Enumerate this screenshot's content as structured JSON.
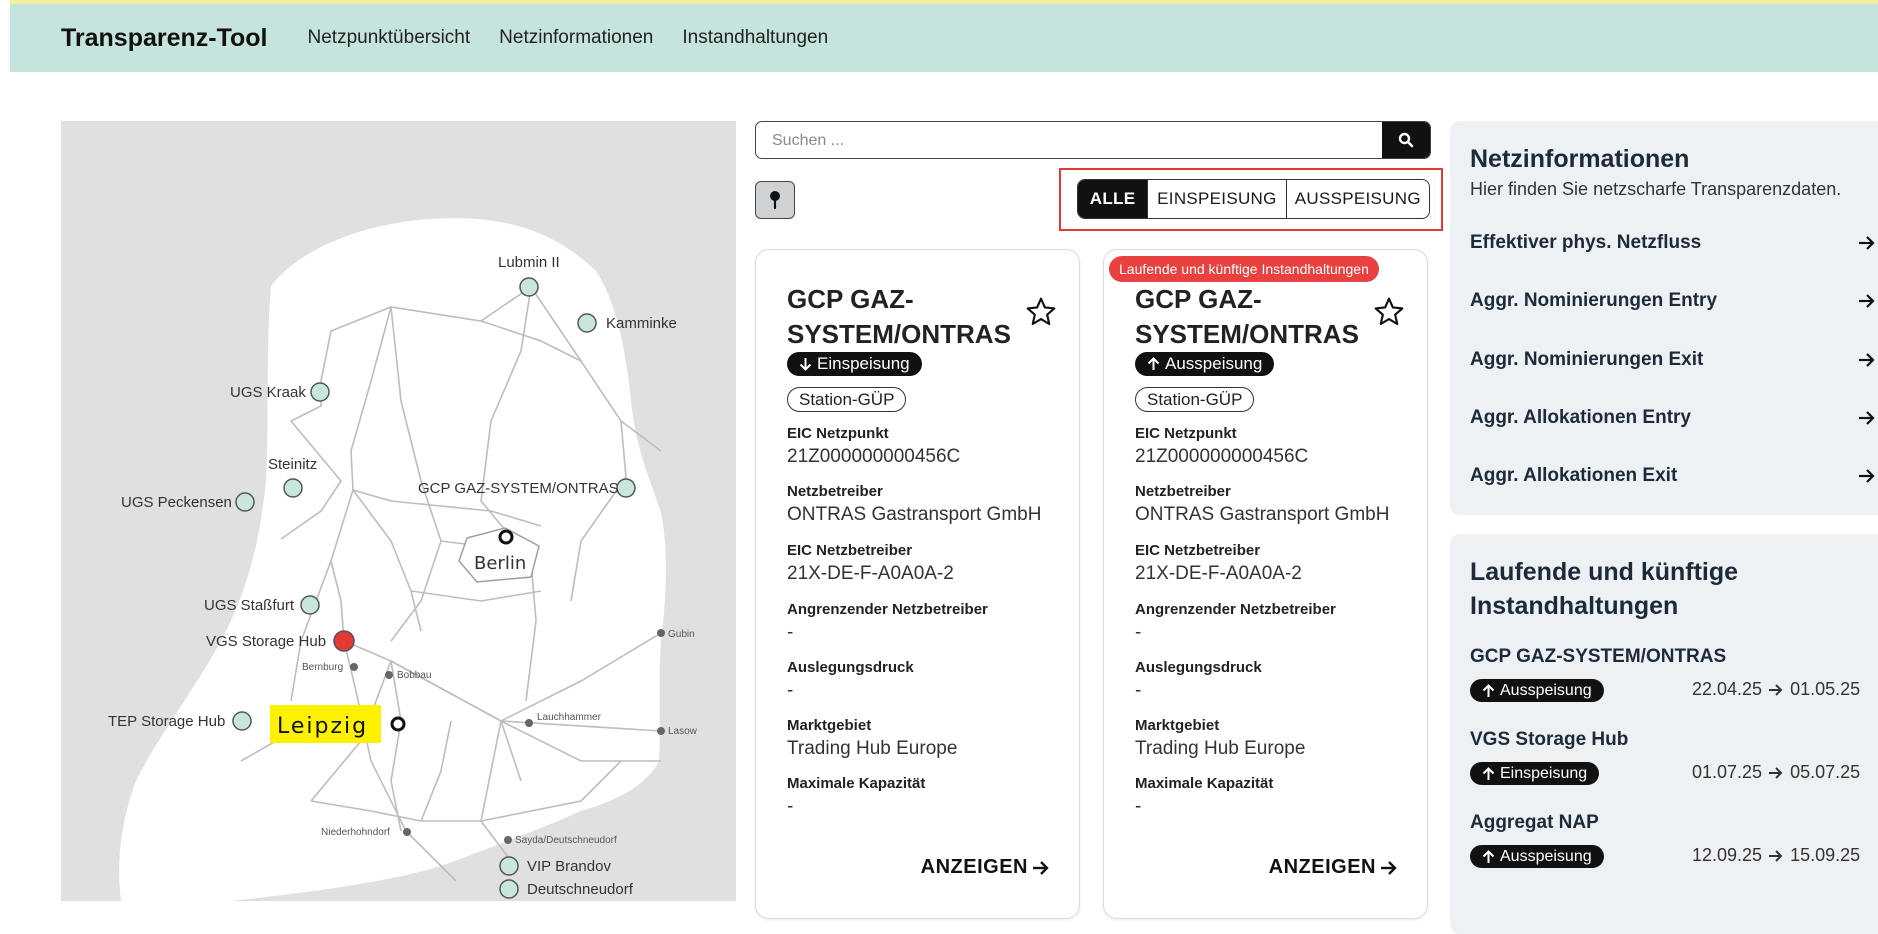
{
  "app": {
    "title": "Transparenz-Tool"
  },
  "nav": [
    {
      "label": "Netzpunktübersicht"
    },
    {
      "label": "Netzinformationen"
    },
    {
      "label": "Instandhaltungen"
    }
  ],
  "colors": {
    "header_bg": "#c5e4dd",
    "node_fill": "#c8e6de",
    "alert_red": "#e53935",
    "highlight_yellow": "#fff200",
    "panel_bg": "#eef1f3"
  },
  "map": {
    "labels": {
      "lubmin": "Lubmin II",
      "kamminke": "Kamminke",
      "ugs_kraak": "UGS Kraak",
      "steinitz": "Steinitz",
      "gcp": "GCP GAZ-SYSTEM/ONTRAS",
      "ugs_peckensen": "UGS Peckensen",
      "berlin": "Berlin",
      "ugs_stassfurt": "UGS Staßfurt",
      "vgs": "VGS Storage Hub",
      "gubin": "Gubin",
      "bernburg": "Bernburg",
      "bobbau": "Bobbau",
      "tep": "TEP Storage Hub",
      "leipzig": "Leipzig",
      "lauchhammer": "Lauchhammer",
      "lasow": "Lasow",
      "niederhohndorf": "Niederhohndorf",
      "sayda": "Sayda/Deutschneudorf",
      "vip_brandov": "VIP Brandov",
      "deutschneudorf": "Deutschneudorf"
    }
  },
  "search": {
    "placeholder": "Suchen ..."
  },
  "filters": [
    {
      "label": "ALLE",
      "active": true
    },
    {
      "label": "EINSPEISUNG",
      "active": false
    },
    {
      "label": "AUSSPEISUNG",
      "active": false
    }
  ],
  "cards": [
    {
      "banner": "",
      "title": "GCP GAZ-SYSTEM/ONTRAS",
      "direction": "Einspeisung",
      "direction_icon": "arrow-down-icon",
      "type": "Station-GÜP",
      "fields": [
        {
          "label": "EIC Netzpunkt",
          "value": "21Z000000000456C"
        },
        {
          "label": "Netzbetreiber",
          "value": "ONTRAS Gastransport GmbH"
        },
        {
          "label": "EIC Netzbetreiber",
          "value": "21X-DE-F-A0A0A-2"
        },
        {
          "label": "Angrenzender Netzbetreiber",
          "value": "-"
        },
        {
          "label": "Auslegungsdruck",
          "value": "-"
        },
        {
          "label": "Marktgebiet",
          "value": "Trading Hub Europe"
        },
        {
          "label": "Maximale Kapazität",
          "value": "-"
        }
      ],
      "button": "ANZEIGEN"
    },
    {
      "banner": "Laufende und künftige Instandhaltungen",
      "title": "GCP GAZ-SYSTEM/ONTRAS",
      "direction": "Ausspeisung",
      "direction_icon": "arrow-up-icon",
      "type": "Station-GÜP",
      "fields": [
        {
          "label": "EIC Netzpunkt",
          "value": "21Z000000000456C"
        },
        {
          "label": "Netzbetreiber",
          "value": "ONTRAS Gastransport GmbH"
        },
        {
          "label": "EIC Netzbetreiber",
          "value": "21X-DE-F-A0A0A-2"
        },
        {
          "label": "Angrenzender Netzbetreiber",
          "value": "-"
        },
        {
          "label": "Auslegungsdruck",
          "value": "-"
        },
        {
          "label": "Marktgebiet",
          "value": "Trading Hub Europe"
        },
        {
          "label": "Maximale Kapazität",
          "value": "-"
        }
      ],
      "button": "ANZEIGEN"
    }
  ],
  "netzinfo": {
    "title": "Netzinformationen",
    "subtitle": "Hier finden Sie netzscharfe Transparenzdaten.",
    "links": [
      {
        "label": "Effektiver phys. Netzfluss"
      },
      {
        "label": "Aggr. Nominierungen Entry"
      },
      {
        "label": "Aggr. Nominierungen Exit"
      },
      {
        "label": "Aggr. Allokationen Entry"
      },
      {
        "label": "Aggr. Allokationen Exit"
      }
    ]
  },
  "maintenance": {
    "title_line1": "Laufende und künftige",
    "title_line2": "Instandhaltungen",
    "items": [
      {
        "name": "GCP GAZ-SYSTEM/ONTRAS",
        "direction": "Ausspeisung",
        "start": "22.04.25",
        "end": "01.05.25"
      },
      {
        "name": "VGS Storage Hub",
        "direction": "Einspeisung",
        "start": "01.07.25",
        "end": "05.07.25"
      },
      {
        "name": "Aggregat NAP",
        "direction": "Ausspeisung",
        "start": "12.09.25",
        "end": "15.09.25"
      }
    ]
  }
}
